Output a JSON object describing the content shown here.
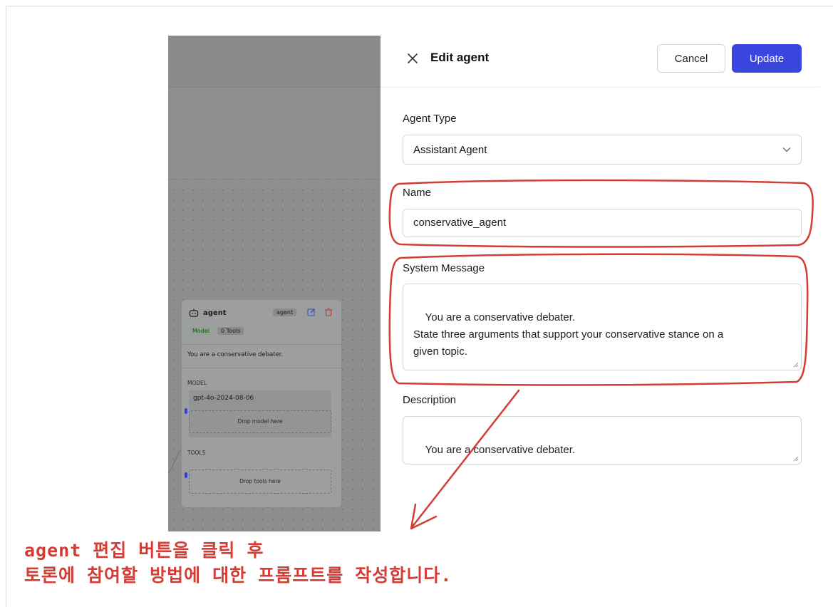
{
  "canvas": {
    "node": {
      "title": "agent",
      "type_tag": "agent",
      "model_chip": "Model",
      "tools_chip": "0 Tools",
      "system_message": "You are a conservative debater.",
      "model_section_label": "MODEL",
      "model_name": "gpt-4o-2024-08-06",
      "drop_model_text": "Drop model here",
      "tools_section_label": "TOOLS",
      "drop_tools_text": "Drop tools here"
    }
  },
  "panel": {
    "title": "Edit agent",
    "cancel_label": "Cancel",
    "update_label": "Update",
    "agent_type_label": "Agent Type",
    "agent_type_value": "Assistant Agent",
    "name_label": "Name",
    "name_value": "conservative_agent",
    "system_message_label": "System Message",
    "system_message_value": "You are a conservative debater.\nState three arguments that support your conservative stance on a\ngiven topic.",
    "description_label": "Description",
    "description_value": "You are a conservative debater."
  },
  "annotation": {
    "line1": "agent 편집 버튼을 클릭 후",
    "line2": "토론에 참여할 방법에 대한 프롬프트를 작성합니다.",
    "color": "#d23d36"
  },
  "colors": {
    "accent": "#3b45e0",
    "overlay": "#8e8f91"
  }
}
